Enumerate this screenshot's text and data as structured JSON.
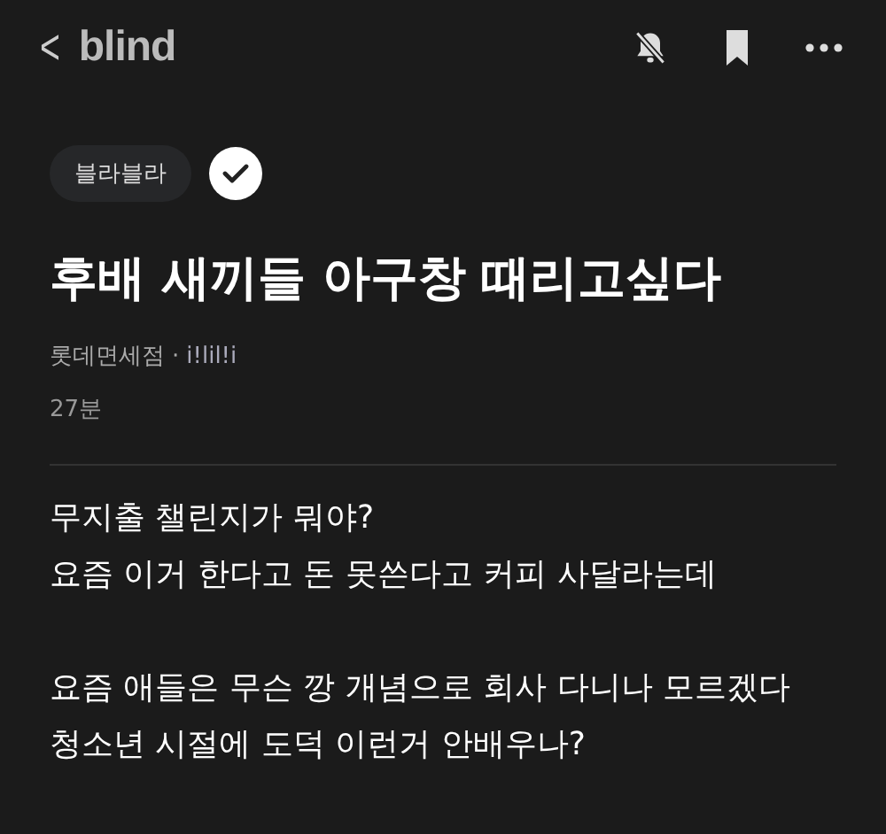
{
  "header": {
    "back": "<",
    "logo": "blind"
  },
  "post": {
    "topic": "블라블라",
    "title": "후배 새끼들 아구창 때리고싶다",
    "company": "롯데면세점",
    "separator": "·",
    "author": "i!lil!i",
    "time": "27분",
    "paragraphs": [
      [
        "무지출 챌린지가 뭐야?",
        "요즘 이거 한다고 돈 못쓴다고 커피 사달라는데"
      ],
      [
        "요즘 애들은 무슨 깡 개념으로 회사 다니나 모르겠다",
        "청소년 시절에 도덕 이런거 안배우나?"
      ]
    ]
  }
}
